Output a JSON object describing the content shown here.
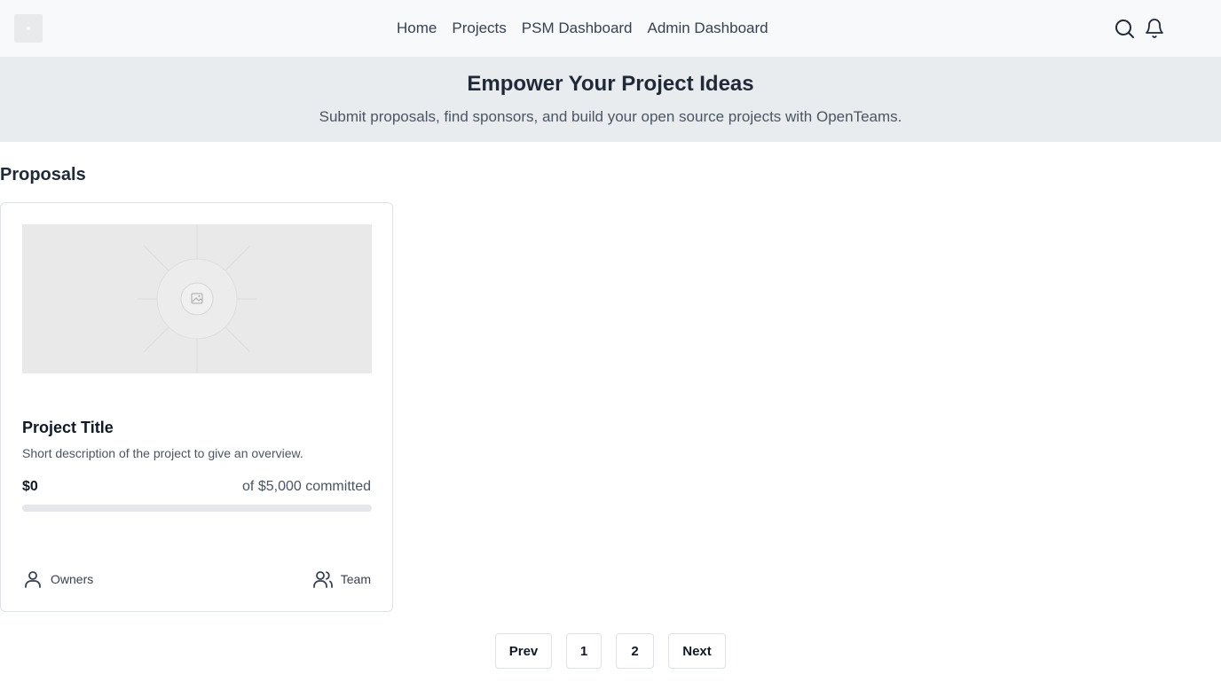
{
  "nav": {
    "links": [
      "Home",
      "Projects",
      "PSM Dashboard",
      "Admin Dashboard"
    ],
    "icons": [
      "search-icon",
      "bell-icon"
    ]
  },
  "hero": {
    "title": "Empower Your Project Ideas",
    "subtitle": "Submit proposals, find sponsors, and build your open source projects with OpenTeams."
  },
  "proposals": {
    "heading": "Proposals",
    "cards": [
      {
        "title": "Project Title",
        "description": "Short description of the project to give an overview.",
        "amount": "$0",
        "goal_text": "of $5,000 committed",
        "progress": 0,
        "owners_label": "Owners",
        "team_label": "Team"
      }
    ]
  },
  "pagination": {
    "prev": "Prev",
    "pages": [
      "1",
      "2"
    ],
    "next": "Next"
  }
}
